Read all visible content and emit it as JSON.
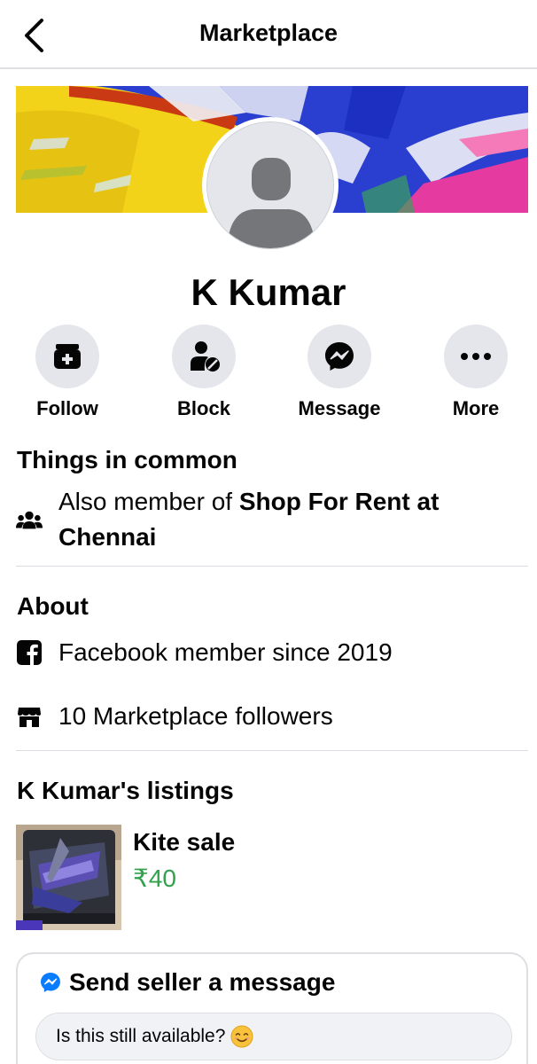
{
  "header": {
    "title": "Marketplace",
    "back_icon": "chevron-left-icon"
  },
  "profile": {
    "name": "K Kumar"
  },
  "actions": [
    {
      "label": "Follow",
      "icon": "follow-store-icon"
    },
    {
      "label": "Block",
      "icon": "block-user-icon"
    },
    {
      "label": "Message",
      "icon": "messenger-icon"
    },
    {
      "label": "More",
      "icon": "more-dots-icon"
    }
  ],
  "common": {
    "title": "Things in common",
    "text_prefix": "Also member of ",
    "group_name": "Shop For Rent at Chennai"
  },
  "about": {
    "title": "About",
    "member_since": "Facebook member since 2019",
    "followers": "10 Marketplace followers"
  },
  "listings": {
    "title": "K Kumar's listings",
    "items": [
      {
        "title": "Kite sale",
        "price": "₹40"
      }
    ]
  },
  "message_box": {
    "title": "Send seller a message",
    "input_value": "Is this still available?",
    "emoji": "smiling-face-icon"
  },
  "colors": {
    "price": "#31a24c",
    "messenger_blue": "#0a7cff",
    "action_bg": "#e4e6eb"
  }
}
